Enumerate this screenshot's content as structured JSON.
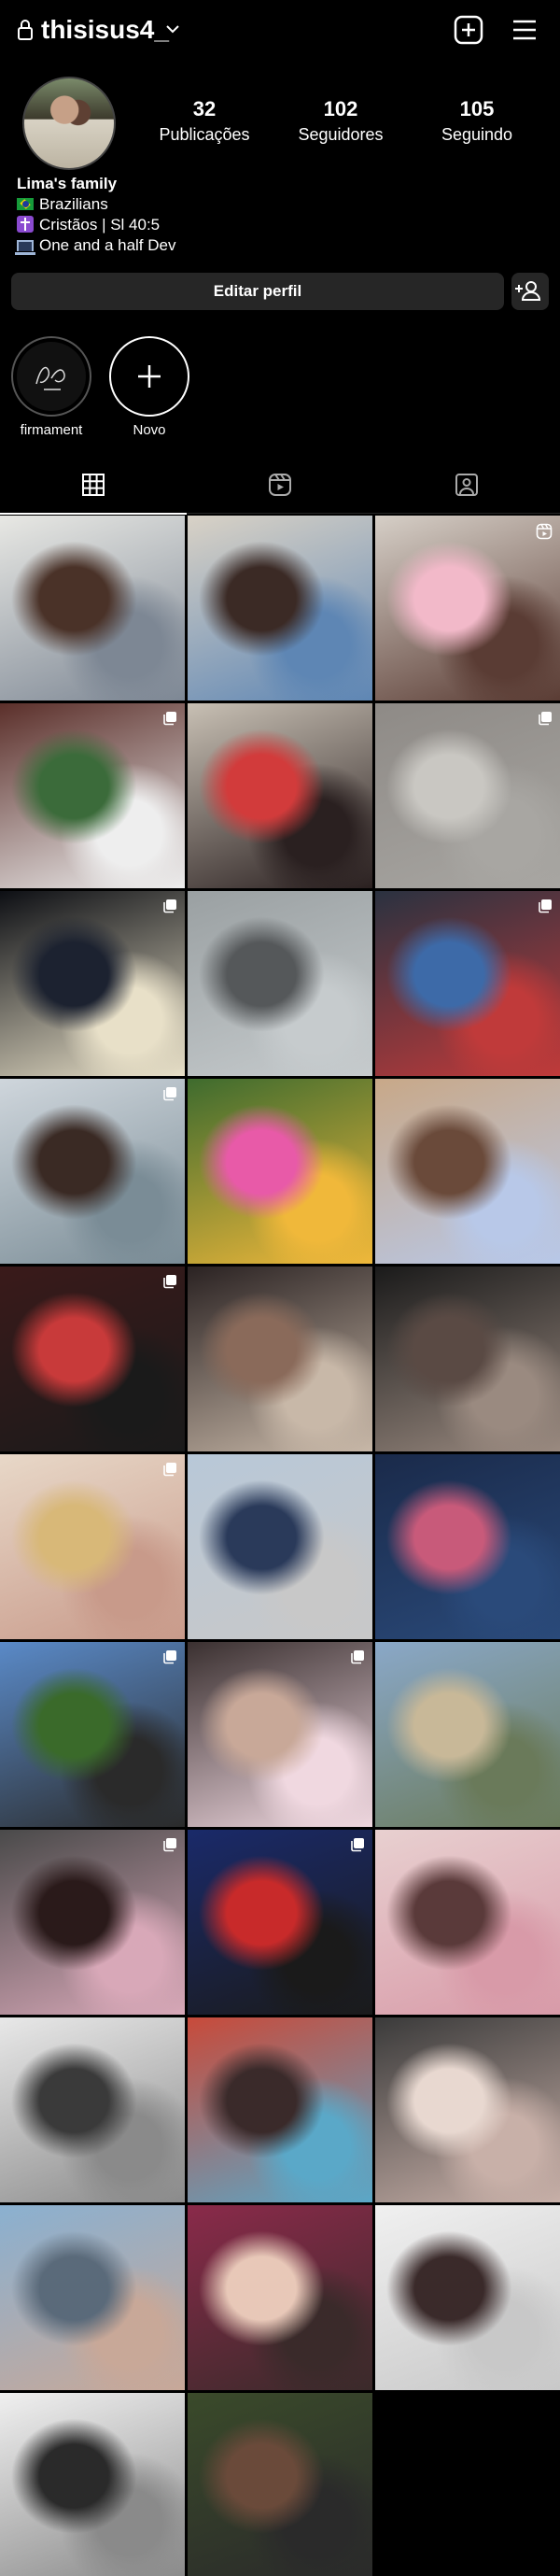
{
  "header": {
    "username": "thisisus4_",
    "icons": [
      "lock-icon",
      "chevron-down-icon",
      "create-post-icon",
      "menu-icon"
    ]
  },
  "profile": {
    "stats": [
      {
        "value": "32",
        "label": "Publicações"
      },
      {
        "value": "102",
        "label": "Seguidores"
      },
      {
        "value": "105",
        "label": "Seguindo"
      }
    ],
    "bio": {
      "name": "Lima's family",
      "lines": [
        {
          "icon": "brazil-flag-icon",
          "text": "Brazilians"
        },
        {
          "icon": "cross-icon",
          "text": "Cristãos | Sl 40:5"
        },
        {
          "icon": "laptop-icon",
          "text": "One and a half Dev"
        }
      ]
    },
    "edit_label": "Editar perfil"
  },
  "highlights": [
    {
      "label": "firmament"
    },
    {
      "label": "Novo"
    }
  ],
  "tabs": [
    {
      "icon": "grid-icon",
      "active": true
    },
    {
      "icon": "reels-icon",
      "active": false
    },
    {
      "icon": "tagged-icon",
      "active": false
    }
  ],
  "posts": [
    {
      "badge": "none",
      "colors": [
        "#e8e8e4",
        "#4a3228",
        "#7d8794"
      ]
    },
    {
      "badge": "none",
      "colors": [
        "#d9d2c6",
        "#3b2a25",
        "#5e86b4"
      ]
    },
    {
      "badge": "reel",
      "colors": [
        "#d6cfc7",
        "#f2b9c9",
        "#5a3c34"
      ]
    },
    {
      "badge": "multi",
      "colors": [
        "#5b2f2a",
        "#3b6b3a",
        "#eeeeee"
      ]
    },
    {
      "badge": "none",
      "colors": [
        "#c8c0b4",
        "#d23b3b",
        "#2a2020"
      ]
    },
    {
      "badge": "multi",
      "colors": [
        "#8e8a86",
        "#c9c7c2",
        "#a8a6a2"
      ]
    },
    {
      "badge": "multi",
      "colors": [
        "#0d0f14",
        "#1c2230",
        "#e8e0c8"
      ]
    },
    {
      "badge": "none",
      "colors": [
        "#9aa0a2",
        "#55585a",
        "#c6cbcd"
      ]
    },
    {
      "badge": "multi",
      "colors": [
        "#2a3240",
        "#3d6aa8",
        "#c03a3a"
      ]
    },
    {
      "badge": "multi",
      "colors": [
        "#cfd6dc",
        "#3a2a24",
        "#7a8c96"
      ]
    },
    {
      "badge": "none",
      "colors": [
        "#3e6b2e",
        "#e85aa8",
        "#f0b83a"
      ]
    },
    {
      "badge": "none",
      "colors": [
        "#c8a888",
        "#6a4a3a",
        "#b8c8e8"
      ]
    },
    {
      "badge": "multi",
      "colors": [
        "#3a1a1a",
        "#c83a3a",
        "#1a1a1a"
      ]
    },
    {
      "badge": "none",
      "colors": [
        "#2a2222",
        "#8a6a5a",
        "#c8b8a8"
      ]
    },
    {
      "badge": "none",
      "colors": [
        "#1a1a1a",
        "#5a4a44",
        "#9a8a80"
      ]
    },
    {
      "badge": "multi",
      "colors": [
        "#e8d8c8",
        "#d8b878",
        "#c89a8a"
      ]
    },
    {
      "badge": "none",
      "colors": [
        "#b8c8d8",
        "#2a3a5a",
        "#c8c8c8"
      ]
    },
    {
      "badge": "none",
      "colors": [
        "#1a2a4a",
        "#c85a7a",
        "#2a4a7a"
      ]
    },
    {
      "badge": "multi",
      "colors": [
        "#5a8ac8",
        "#3a6a2a",
        "#2a2a2a"
      ]
    },
    {
      "badge": "multi",
      "colors": [
        "#3a3030",
        "#c8a898",
        "#f0d8e0"
      ]
    },
    {
      "badge": "none",
      "colors": [
        "#8aa8c8",
        "#c8b898",
        "#6a7a5a"
      ]
    },
    {
      "badge": "multi",
      "colors": [
        "#4a4a4a",
        "#2a1a1a",
        "#d8a8b8"
      ]
    },
    {
      "badge": "multi",
      "colors": [
        "#1a2a6a",
        "#c82a2a",
        "#1a1a1a"
      ]
    },
    {
      "badge": "none",
      "colors": [
        "#e8d0d0",
        "#5a3a3a",
        "#d89aa8"
      ]
    },
    {
      "badge": "none",
      "colors": [
        "#e8e8e8",
        "#3a3a3a",
        "#8a8a8a"
      ]
    },
    {
      "badge": "none",
      "colors": [
        "#c84a3a",
        "#3a2a2a",
        "#5aa8c8"
      ]
    },
    {
      "badge": "none",
      "colors": [
        "#3a3a3a",
        "#e8d8d0",
        "#c8b0a8"
      ]
    },
    {
      "badge": "none",
      "colors": [
        "#8ab0d0",
        "#5a6a7a",
        "#c8a898"
      ]
    },
    {
      "badge": "none",
      "colors": [
        "#8a2a4a",
        "#e8c8b8",
        "#3a2a2a"
      ]
    },
    {
      "badge": "none",
      "colors": [
        "#f0f0f0",
        "#3a2a2a",
        "#c8c8c8"
      ]
    },
    {
      "badge": "none",
      "colors": [
        "#f0f0f0",
        "#2a2a2a",
        "#8a8a8a"
      ]
    },
    {
      "badge": "none",
      "colors": [
        "#3a4a2a",
        "#6a4a3a",
        "#2a2a2a"
      ]
    }
  ],
  "colors": {
    "background": "#000000",
    "button_bg": "#262626",
    "text": "#ffffff"
  }
}
